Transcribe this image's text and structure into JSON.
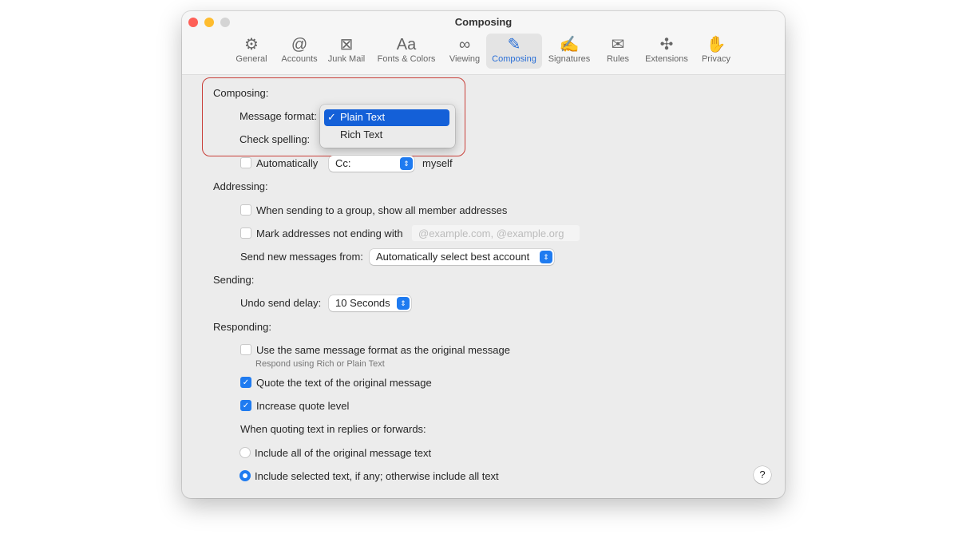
{
  "window": {
    "title": "Composing"
  },
  "toolbar": {
    "tabs": [
      {
        "label": "General",
        "icon": "gear-icon",
        "glyph": "⚙"
      },
      {
        "label": "Accounts",
        "icon": "at-icon",
        "glyph": "@"
      },
      {
        "label": "Junk Mail",
        "icon": "junk-bin-icon",
        "glyph": "⊠"
      },
      {
        "label": "Fonts & Colors",
        "icon": "font-icon",
        "glyph": "Aa"
      },
      {
        "label": "Viewing",
        "icon": "glasses-icon",
        "glyph": "∞"
      },
      {
        "label": "Composing",
        "icon": "compose-icon",
        "glyph": "✎",
        "selected": true
      },
      {
        "label": "Signatures",
        "icon": "signature-icon",
        "glyph": "✍"
      },
      {
        "label": "Rules",
        "icon": "rules-envelope-icon",
        "glyph": "✉"
      },
      {
        "label": "Extensions",
        "icon": "puzzle-icon",
        "glyph": "✣"
      },
      {
        "label": "Privacy",
        "icon": "hand-icon",
        "glyph": "✋"
      }
    ]
  },
  "composing": {
    "heading": "Composing:",
    "message_format_label": "Message format:",
    "check_spelling_label": "Check spelling:",
    "format_menu": {
      "options": [
        "Plain Text",
        "Rich Text"
      ],
      "selected": "Plain Text"
    },
    "auto_label": "Automatically",
    "auto_checked": false,
    "cc_value": "Cc:",
    "myself": "myself"
  },
  "addressing": {
    "heading": "Addressing:",
    "show_members": "When sending to a group, show all member addresses",
    "show_members_checked": false,
    "mark_addresses": "Mark addresses not ending with",
    "mark_checked": false,
    "mark_placeholder": "@example.com, @example.org",
    "send_from_label": "Send new messages from:",
    "send_from_value": "Automatically select best account"
  },
  "sending": {
    "heading": "Sending:",
    "undo_label": "Undo send delay:",
    "undo_value": "10 Seconds"
  },
  "responding": {
    "heading": "Responding:",
    "same_format": "Use the same message format as the original message",
    "same_format_checked": false,
    "same_format_hint": "Respond using Rich or Plain Text",
    "quote_text": "Quote the text of the original message",
    "quote_checked": true,
    "increase_quote": "Increase quote level",
    "increase_checked": true,
    "quoting_label": "When quoting text in replies or forwards:",
    "include_all": "Include all of the original message text",
    "include_selected": "Include selected text, if any; otherwise include all text",
    "selected_option": "include_selected"
  },
  "help": "?",
  "colors": {
    "accent": "#1f7bf0",
    "highlight_border": "#c9403a"
  }
}
